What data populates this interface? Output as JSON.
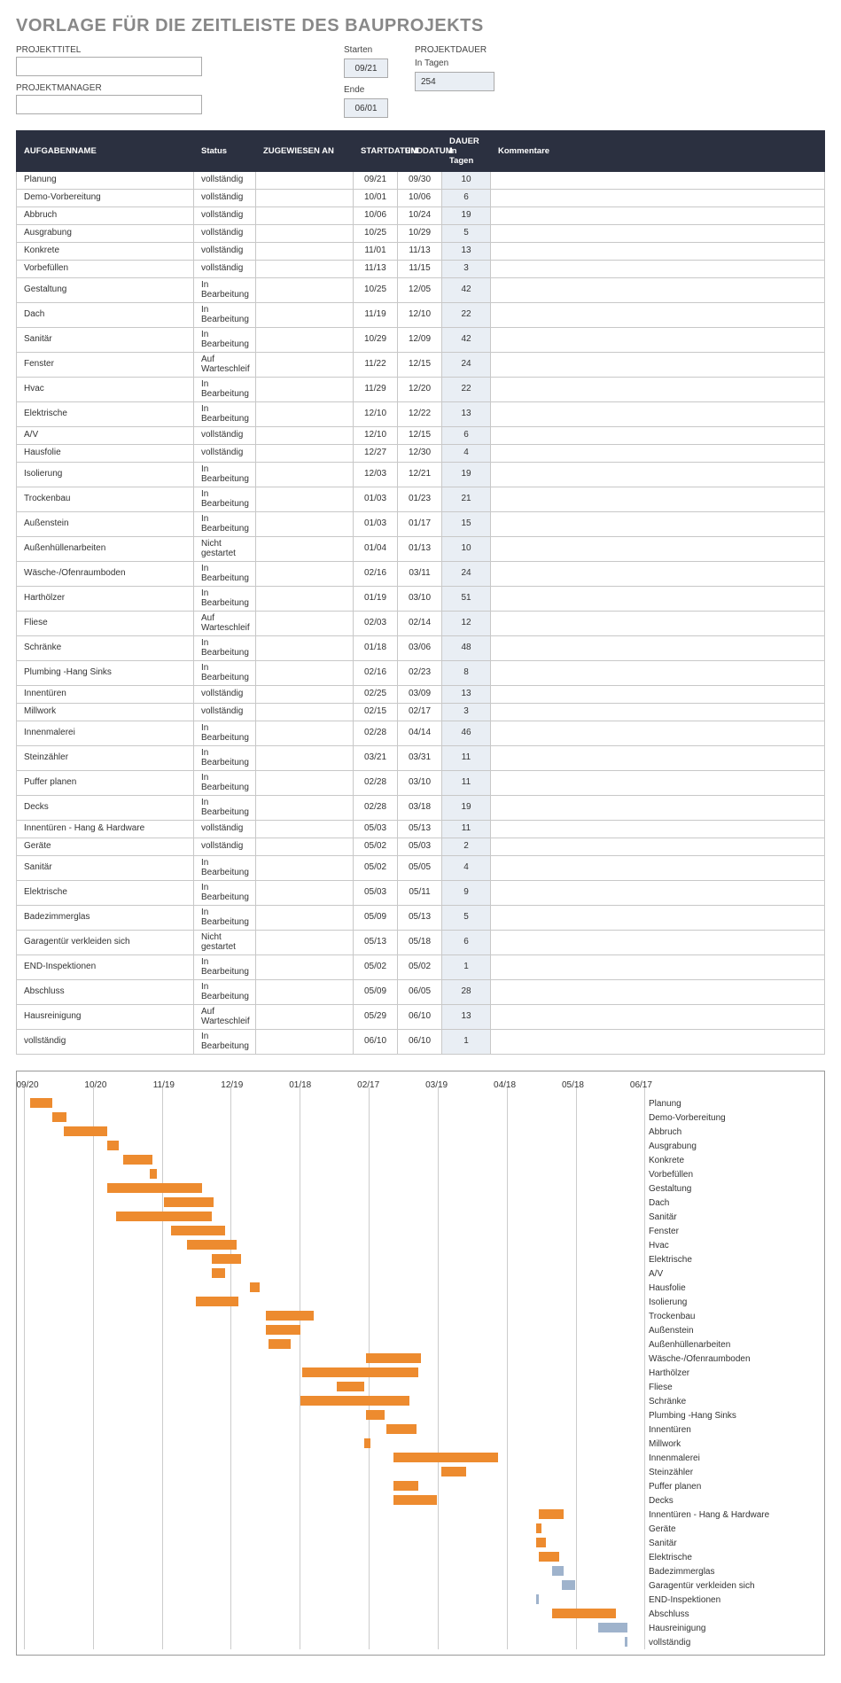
{
  "title": "VORLAGE FÜR DIE ZEITLEISTE DES BAUPROJEKTS",
  "meta": {
    "project_title_label": "PROJEKTTITEL",
    "project_title_value": "",
    "project_manager_label": "PROJEKTMANAGER",
    "project_manager_value": "",
    "start_label": "Starten",
    "start_value": "09/21",
    "end_label": "Ende",
    "end_value": "06/01",
    "duration_label": "PROJEKTDAUER",
    "duration_unit": "In Tagen",
    "duration_value": "254"
  },
  "columns": {
    "name": "AUFGABENNAME",
    "status": "Status",
    "assigned": "ZUGEWIESEN AN",
    "start": "STARTDATUM",
    "end": "ENDDATUM",
    "duration": "DAUER In Tagen",
    "comments": "Kommentare"
  },
  "tasks": [
    {
      "name": "Planung",
      "status": "vollständig",
      "assigned": "",
      "start": "09/21",
      "end": "09/30",
      "dur": "10",
      "comm": ""
    },
    {
      "name": "Demo-Vorbereitung",
      "status": "vollständig",
      "assigned": "",
      "start": "10/01",
      "end": "10/06",
      "dur": "6",
      "comm": ""
    },
    {
      "name": "Abbruch",
      "status": "vollständig",
      "assigned": "",
      "start": "10/06",
      "end": "10/24",
      "dur": "19",
      "comm": ""
    },
    {
      "name": "Ausgrabung",
      "status": "vollständig",
      "assigned": "",
      "start": "10/25",
      "end": "10/29",
      "dur": "5",
      "comm": ""
    },
    {
      "name": "Konkrete",
      "status": "vollständig",
      "assigned": "",
      "start": "11/01",
      "end": "11/13",
      "dur": "13",
      "comm": ""
    },
    {
      "name": "Vorbefüllen",
      "status": "vollständig",
      "assigned": "",
      "start": "11/13",
      "end": "11/15",
      "dur": "3",
      "comm": ""
    },
    {
      "name": "Gestaltung",
      "status": "In Bearbeitung",
      "assigned": "",
      "start": "10/25",
      "end": "12/05",
      "dur": "42",
      "comm": ""
    },
    {
      "name": "Dach",
      "status": "In Bearbeitung",
      "assigned": "",
      "start": "11/19",
      "end": "12/10",
      "dur": "22",
      "comm": ""
    },
    {
      "name": "Sanitär",
      "status": "In Bearbeitung",
      "assigned": "",
      "start": "10/29",
      "end": "12/09",
      "dur": "42",
      "comm": ""
    },
    {
      "name": "Fenster",
      "status": "Auf Warteschleif",
      "assigned": "",
      "start": "11/22",
      "end": "12/15",
      "dur": "24",
      "comm": ""
    },
    {
      "name": "Hvac",
      "status": "In Bearbeitung",
      "assigned": "",
      "start": "11/29",
      "end": "12/20",
      "dur": "22",
      "comm": ""
    },
    {
      "name": "Elektrische",
      "status": "In Bearbeitung",
      "assigned": "",
      "start": "12/10",
      "end": "12/22",
      "dur": "13",
      "comm": ""
    },
    {
      "name": "A/V",
      "status": "vollständig",
      "assigned": "",
      "start": "12/10",
      "end": "12/15",
      "dur": "6",
      "comm": ""
    },
    {
      "name": "Hausfolie",
      "status": "vollständig",
      "assigned": "",
      "start": "12/27",
      "end": "12/30",
      "dur": "4",
      "comm": ""
    },
    {
      "name": "Isolierung",
      "status": "In Bearbeitung",
      "assigned": "",
      "start": "12/03",
      "end": "12/21",
      "dur": "19",
      "comm": ""
    },
    {
      "name": "Trockenbau",
      "status": "In Bearbeitung",
      "assigned": "",
      "start": "01/03",
      "end": "01/23",
      "dur": "21",
      "comm": ""
    },
    {
      "name": "Außenstein",
      "status": "In Bearbeitung",
      "assigned": "",
      "start": "01/03",
      "end": "01/17",
      "dur": "15",
      "comm": ""
    },
    {
      "name": "Außenhüllenarbeiten",
      "status": "Nicht gestartet",
      "assigned": "",
      "start": "01/04",
      "end": "01/13",
      "dur": "10",
      "comm": ""
    },
    {
      "name": "Wäsche-/Ofenraumboden",
      "status": "In Bearbeitung",
      "assigned": "",
      "start": "02/16",
      "end": "03/11",
      "dur": "24",
      "comm": ""
    },
    {
      "name": "Harthölzer",
      "status": "In Bearbeitung",
      "assigned": "",
      "start": "01/19",
      "end": "03/10",
      "dur": "51",
      "comm": ""
    },
    {
      "name": "Fliese",
      "status": "Auf Warteschleif",
      "assigned": "",
      "start": "02/03",
      "end": "02/14",
      "dur": "12",
      "comm": ""
    },
    {
      "name": "Schränke",
      "status": "In Bearbeitung",
      "assigned": "",
      "start": "01/18",
      "end": "03/06",
      "dur": "48",
      "comm": ""
    },
    {
      "name": "Plumbing -Hang Sinks",
      "status": "In Bearbeitung",
      "assigned": "",
      "start": "02/16",
      "end": "02/23",
      "dur": "8",
      "comm": ""
    },
    {
      "name": "Innentüren",
      "status": "vollständig",
      "assigned": "",
      "start": "02/25",
      "end": "03/09",
      "dur": "13",
      "comm": ""
    },
    {
      "name": "Millwork",
      "status": "vollständig",
      "assigned": "",
      "start": "02/15",
      "end": "02/17",
      "dur": "3",
      "comm": ""
    },
    {
      "name": "Innenmalerei",
      "status": "In Bearbeitung",
      "assigned": "",
      "start": "02/28",
      "end": "04/14",
      "dur": "46",
      "comm": ""
    },
    {
      "name": "Steinzähler",
      "status": "In Bearbeitung",
      "assigned": "",
      "start": "03/21",
      "end": "03/31",
      "dur": "11",
      "comm": ""
    },
    {
      "name": "Puffer planen",
      "status": "In Bearbeitung",
      "assigned": "",
      "start": "02/28",
      "end": "03/10",
      "dur": "11",
      "comm": ""
    },
    {
      "name": "Decks",
      "status": "In Bearbeitung",
      "assigned": "",
      "start": "02/28",
      "end": "03/18",
      "dur": "19",
      "comm": ""
    },
    {
      "name": "Innentüren - Hang & Hardware",
      "status": "vollständig",
      "assigned": "",
      "start": "05/03",
      "end": "05/13",
      "dur": "11",
      "comm": ""
    },
    {
      "name": "Geräte",
      "status": "vollständig",
      "assigned": "",
      "start": "05/02",
      "end": "05/03",
      "dur": "2",
      "comm": ""
    },
    {
      "name": "Sanitär",
      "status": "In Bearbeitung",
      "assigned": "",
      "start": "05/02",
      "end": "05/05",
      "dur": "4",
      "comm": ""
    },
    {
      "name": "Elektrische",
      "status": "In Bearbeitung",
      "assigned": "",
      "start": "05/03",
      "end": "05/11",
      "dur": "9",
      "comm": ""
    },
    {
      "name": "Badezimmerglas",
      "status": "In Bearbeitung",
      "assigned": "",
      "start": "05/09",
      "end": "05/13",
      "dur": "5",
      "comm": ""
    },
    {
      "name": "Garagentür verkleiden sich",
      "status": "Nicht gestartet",
      "assigned": "",
      "start": "05/13",
      "end": "05/18",
      "dur": "6",
      "comm": ""
    },
    {
      "name": "END-Inspektionen",
      "status": "In Bearbeitung",
      "assigned": "",
      "start": "05/02",
      "end": "05/02",
      "dur": "1",
      "comm": ""
    },
    {
      "name": "Abschluss",
      "status": "In Bearbeitung",
      "assigned": "",
      "start": "05/09",
      "end": "06/05",
      "dur": "28",
      "comm": ""
    },
    {
      "name": "Hausreinigung",
      "status": "Auf Warteschleif",
      "assigned": "",
      "start": "05/29",
      "end": "06/10",
      "dur": "13",
      "comm": ""
    },
    {
      "name": "vollständig",
      "status": "In Bearbeitung",
      "assigned": "",
      "start": "06/10",
      "end": "06/10",
      "dur": "1",
      "comm": ""
    }
  ],
  "gantt": {
    "axis_start_day": -1,
    "axis_end_day": 270,
    "ticks": [
      "09/20",
      "10/20",
      "11/19",
      "12/19",
      "01/18",
      "02/17",
      "03/19",
      "04/18",
      "05/18",
      "06/17"
    ],
    "blue_names": [
      "Badezimmerglas",
      "Garagentür verkleiden sich",
      "END-Inspektionen",
      "Hausreinigung",
      "vollständig"
    ]
  },
  "chart_data": {
    "type": "bar",
    "title": "",
    "xlabel": "",
    "ylabel": "",
    "x_ticks": [
      "09/20",
      "10/20",
      "11/19",
      "12/19",
      "01/18",
      "02/17",
      "03/19",
      "04/18",
      "05/18",
      "06/17"
    ],
    "x_range_days": [
      -1,
      270
    ],
    "series": [
      {
        "name": "Planung",
        "start": "09/21",
        "end": "09/30",
        "duration": 10,
        "color": "orange"
      },
      {
        "name": "Demo-Vorbereitung",
        "start": "10/01",
        "end": "10/06",
        "duration": 6,
        "color": "orange"
      },
      {
        "name": "Abbruch",
        "start": "10/06",
        "end": "10/24",
        "duration": 19,
        "color": "orange"
      },
      {
        "name": "Ausgrabung",
        "start": "10/25",
        "end": "10/29",
        "duration": 5,
        "color": "orange"
      },
      {
        "name": "Konkrete",
        "start": "11/01",
        "end": "11/13",
        "duration": 13,
        "color": "orange"
      },
      {
        "name": "Vorbefüllen",
        "start": "11/13",
        "end": "11/15",
        "duration": 3,
        "color": "orange"
      },
      {
        "name": "Gestaltung",
        "start": "10/25",
        "end": "12/05",
        "duration": 42,
        "color": "orange"
      },
      {
        "name": "Dach",
        "start": "11/19",
        "end": "12/10",
        "duration": 22,
        "color": "orange"
      },
      {
        "name": "Sanitär",
        "start": "10/29",
        "end": "12/09",
        "duration": 42,
        "color": "orange"
      },
      {
        "name": "Fenster",
        "start": "11/22",
        "end": "12/15",
        "duration": 24,
        "color": "orange"
      },
      {
        "name": "Hvac",
        "start": "11/29",
        "end": "12/20",
        "duration": 22,
        "color": "orange"
      },
      {
        "name": "Elektrische",
        "start": "12/10",
        "end": "12/22",
        "duration": 13,
        "color": "orange"
      },
      {
        "name": "A/V",
        "start": "12/10",
        "end": "12/15",
        "duration": 6,
        "color": "orange"
      },
      {
        "name": "Hausfolie",
        "start": "12/27",
        "end": "12/30",
        "duration": 4,
        "color": "orange"
      },
      {
        "name": "Isolierung",
        "start": "12/03",
        "end": "12/21",
        "duration": 19,
        "color": "orange"
      },
      {
        "name": "Trockenbau",
        "start": "01/03",
        "end": "01/23",
        "duration": 21,
        "color": "orange"
      },
      {
        "name": "Außenstein",
        "start": "01/03",
        "end": "01/17",
        "duration": 15,
        "color": "orange"
      },
      {
        "name": "Außenhüllenarbeiten",
        "start": "01/04",
        "end": "01/13",
        "duration": 10,
        "color": "orange"
      },
      {
        "name": "Wäsche-/Ofenraumboden",
        "start": "02/16",
        "end": "03/11",
        "duration": 24,
        "color": "orange"
      },
      {
        "name": "Harthölzer",
        "start": "01/19",
        "end": "03/10",
        "duration": 51,
        "color": "orange"
      },
      {
        "name": "Fliese",
        "start": "02/03",
        "end": "02/14",
        "duration": 12,
        "color": "orange"
      },
      {
        "name": "Schränke",
        "start": "01/18",
        "end": "03/06",
        "duration": 48,
        "color": "orange"
      },
      {
        "name": "Plumbing -Hang Sinks",
        "start": "02/16",
        "end": "02/23",
        "duration": 8,
        "color": "orange"
      },
      {
        "name": "Innentüren",
        "start": "02/25",
        "end": "03/09",
        "duration": 13,
        "color": "orange"
      },
      {
        "name": "Millwork",
        "start": "02/15",
        "end": "02/17",
        "duration": 3,
        "color": "orange"
      },
      {
        "name": "Innenmalerei",
        "start": "02/28",
        "end": "04/14",
        "duration": 46,
        "color": "orange"
      },
      {
        "name": "Steinzähler",
        "start": "03/21",
        "end": "03/31",
        "duration": 11,
        "color": "orange"
      },
      {
        "name": "Puffer planen",
        "start": "02/28",
        "end": "03/10",
        "duration": 11,
        "color": "orange"
      },
      {
        "name": "Decks",
        "start": "02/28",
        "end": "03/18",
        "duration": 19,
        "color": "orange"
      },
      {
        "name": "Innentüren - Hang & Hardware",
        "start": "05/03",
        "end": "05/13",
        "duration": 11,
        "color": "orange"
      },
      {
        "name": "Geräte",
        "start": "05/02",
        "end": "05/03",
        "duration": 2,
        "color": "orange"
      },
      {
        "name": "Sanitär",
        "start": "05/02",
        "end": "05/05",
        "duration": 4,
        "color": "orange"
      },
      {
        "name": "Elektrische",
        "start": "05/03",
        "end": "05/11",
        "duration": 9,
        "color": "orange"
      },
      {
        "name": "Badezimmerglas",
        "start": "05/09",
        "end": "05/13",
        "duration": 5,
        "color": "blue"
      },
      {
        "name": "Garagentür verkleiden sich",
        "start": "05/13",
        "end": "05/18",
        "duration": 6,
        "color": "blue"
      },
      {
        "name": "END-Inspektionen",
        "start": "05/02",
        "end": "05/02",
        "duration": 1,
        "color": "blue"
      },
      {
        "name": "Abschluss",
        "start": "05/09",
        "end": "06/05",
        "duration": 28,
        "color": "orange"
      },
      {
        "name": "Hausreinigung",
        "start": "05/29",
        "end": "06/10",
        "duration": 13,
        "color": "blue"
      },
      {
        "name": "vollständig",
        "start": "06/10",
        "end": "06/10",
        "duration": 1,
        "color": "blue"
      }
    ]
  }
}
